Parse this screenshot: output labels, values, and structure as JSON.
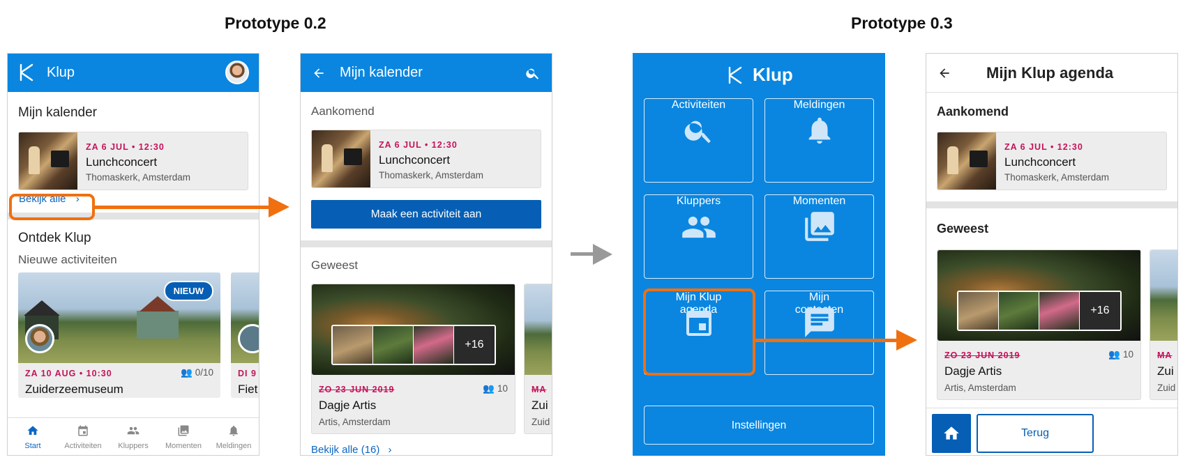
{
  "prototypes": {
    "left_title": "Prototype 0.2",
    "right_title": "Prototype 0.3"
  },
  "colors": {
    "blue": "#0a86e0",
    "dark_blue": "#065fb5",
    "orange": "#f07010",
    "date_red": "#c3135a"
  },
  "screen1": {
    "app_title": "Klup",
    "calendar_heading": "Mijn kalender",
    "event": {
      "date": "ZA 6 JUL • 12:30",
      "title": "Lunchconcert",
      "place": "Thomaskerk, Amsterdam"
    },
    "view_all": "Bekijk alle",
    "discover_heading": "Ontdek Klup",
    "new_activities": "Nieuwe activiteiten",
    "new_badge": "NIEUW",
    "card1": {
      "date": "ZA 10 AUG • 10:30",
      "count": "0/10",
      "title": "Zuiderzeemuseum"
    },
    "card2": {
      "date": "DI 9",
      "title": "Fiet"
    },
    "nav": [
      {
        "label": "Start",
        "icon": "home-icon"
      },
      {
        "label": "Activiteiten",
        "icon": "calendar-icon"
      },
      {
        "label": "Kluppers",
        "icon": "people-icon"
      },
      {
        "label": "Momenten",
        "icon": "photos-icon"
      },
      {
        "label": "Meldingen",
        "icon": "bell-icon"
      }
    ]
  },
  "screen2": {
    "title": "Mijn kalender",
    "upcoming": "Aankomend",
    "event": {
      "date": "ZA 6 JUL • 12:30",
      "title": "Lunchconcert",
      "place": "Thomaskerk, Amsterdam"
    },
    "create_button": "Maak een activiteit aan",
    "past": "Geweest",
    "past_event": {
      "date": "ZO 23 JUN 2019",
      "count": "10",
      "title": "Dagje Artis",
      "place": "Artis, Amsterdam"
    },
    "more_photos": "+16",
    "peek_event": {
      "date": "MA",
      "title": "Zui",
      "place": "Zuid"
    },
    "view_all": "Bekijk alle (16)"
  },
  "screen3": {
    "app_title": "Klup",
    "tiles": [
      {
        "label": "Activiteiten",
        "icon": "search-icon"
      },
      {
        "label": "Meldingen",
        "icon": "bell-icon"
      },
      {
        "label": "Kluppers",
        "icon": "people-icon"
      },
      {
        "label": "Momenten",
        "icon": "photos-icon"
      },
      {
        "label_line1": "Mijn Klup",
        "label_line2": "agenda",
        "icon": "calendar-icon"
      },
      {
        "label_line1": "Mijn",
        "label_line2": "contacten",
        "icon": "chat-icon"
      }
    ],
    "settings": "Instellingen"
  },
  "screen4": {
    "title": "Mijn Klup agenda",
    "upcoming": "Aankomend",
    "event": {
      "date": "ZA 6 JUL • 12:30",
      "title": "Lunchconcert",
      "place": "Thomaskerk, Amsterdam"
    },
    "past": "Geweest",
    "past_event": {
      "date": "ZO 23 JUN 2019",
      "count": "10",
      "title": "Dagje Artis",
      "place": "Artis, Amsterdam"
    },
    "more_photos": "+16",
    "peek_event": {
      "date": "MA",
      "title": "Zui",
      "place": "Zuid"
    },
    "back_button": "Terug"
  }
}
